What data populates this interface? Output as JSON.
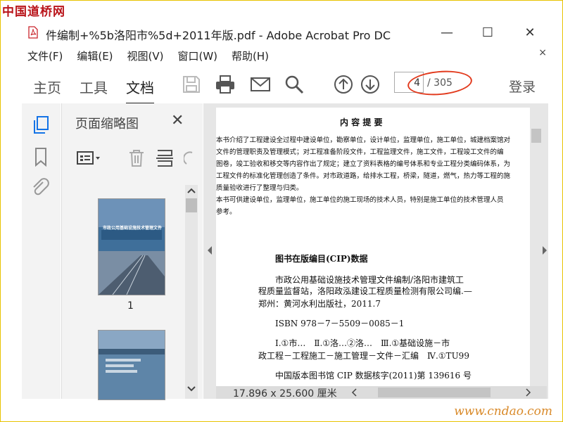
{
  "watermark": {
    "top": "中国道桥网",
    "bottom": "www.cndao.com"
  },
  "window": {
    "title": "件编制+%5b洛阳市%5d+2011年版.pdf - Adobe Acrobat Pro DC",
    "minimize_glyph": "—",
    "maximize_glyph": "☐",
    "close_glyph": "✕"
  },
  "menu": {
    "items": [
      "文件(F)",
      "编辑(E)",
      "视图(V)",
      "窗口(W)",
      "帮助(H)"
    ],
    "close_glyph": "×"
  },
  "toolbar": {
    "tabs": [
      "主页",
      "工具",
      "文档"
    ],
    "active_tab": "文档",
    "page_input_value": "4",
    "page_total": "/ 305",
    "login_label": "登录",
    "icons": [
      "save-icon",
      "print-icon",
      "mail-icon",
      "search-icon",
      "page-up-icon",
      "page-down-icon"
    ]
  },
  "left_rail": {
    "icons": [
      "page-thumbnails-icon",
      "bookmark-icon",
      "attachment-icon"
    ]
  },
  "thumbnail_panel": {
    "title": "页面缩略图",
    "close_glyph": "✕",
    "tools": [
      "thumbnail-options-icon",
      "delete-icon",
      "extract-icon",
      "rotate-icon"
    ],
    "thumbnails": [
      {
        "label": "1",
        "cover_title": "市政公用基础设施技术管理文件编制"
      },
      {
        "label": "",
        "cover_title": ""
      }
    ]
  },
  "document": {
    "heading": "内 容 提 要",
    "abstract_lines": [
      "本书介绍了工程建设全过程中建设单位，勘察单位，设计单位，监理单位，施工单位，城建档案馆对",
      "文件的管理职责及管理模式；对工程准备阶段文件，工程监理文件，施工文件，工程竣工文件的编",
      "图卷，竣工验收和移交等内容作出了规定；建立了资料表格的编号体系和专业工程分类编码体系，为",
      "工程文件的标准化管理创造了条件。对市政道路，给排水工程，桥梁，隧道，燃气，热力等工程的施",
      "质量验收进行了整理与归类。",
      "本书可供建设单位，监理单位，施工单位的施工现场的技术人员，特别是施工单位的技术管理人员",
      "参考。"
    ],
    "cip_heading": "图书在版编目(CIP)数据",
    "cip_lines": [
      "市政公用基础设施技术管理文件编制/洛阳市建筑工",
      "程质量监督站，洛阳政泓建设工程质量检测有限公司编.—",
      "郑州：黄河水利出版社，2011.7"
    ],
    "isbn": "ISBN 978－7－5509－0085－1",
    "class_lines": [
      "Ⅰ.①市…　Ⅱ.①洛…②洛…　Ⅲ.①基础设施－市",
      "政工程－工程施工－施工管理－文件－汇编　Ⅳ.①TU99"
    ],
    "cip_number": "中国版本图书馆 CIP 数据核字(2011)第 139616 号"
  },
  "status": {
    "page_size": "17.896 x 25.600 厘米"
  },
  "colors": {
    "accent_blue": "#1473e6",
    "annotation_red": "#e23b1e",
    "watermark_red": "#b9141a"
  }
}
